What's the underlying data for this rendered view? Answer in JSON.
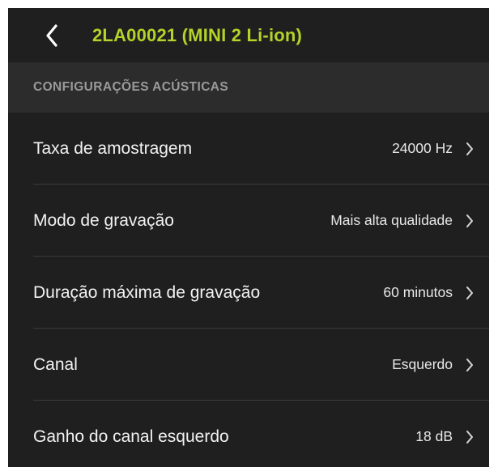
{
  "header": {
    "title": "2LA00021 (MINI 2 Li-ion)",
    "back_icon": "chevron-left-icon"
  },
  "section": {
    "title": "CONFIGURAÇÕES ACÚSTICAS"
  },
  "settings": [
    {
      "label": "Taxa de amostragem",
      "value": "24000 Hz"
    },
    {
      "label": "Modo de gravação",
      "value": "Mais alta qualidade"
    },
    {
      "label": "Duração máxima de gravação",
      "value": "60 minutos"
    },
    {
      "label": "Canal",
      "value": "Esquerdo"
    },
    {
      "label": "Ganho do canal esquerdo",
      "value": "18 dB"
    }
  ],
  "colors": {
    "accent": "#b4d229",
    "background": "#1f1f1f",
    "section_background": "#2c2c2c"
  }
}
